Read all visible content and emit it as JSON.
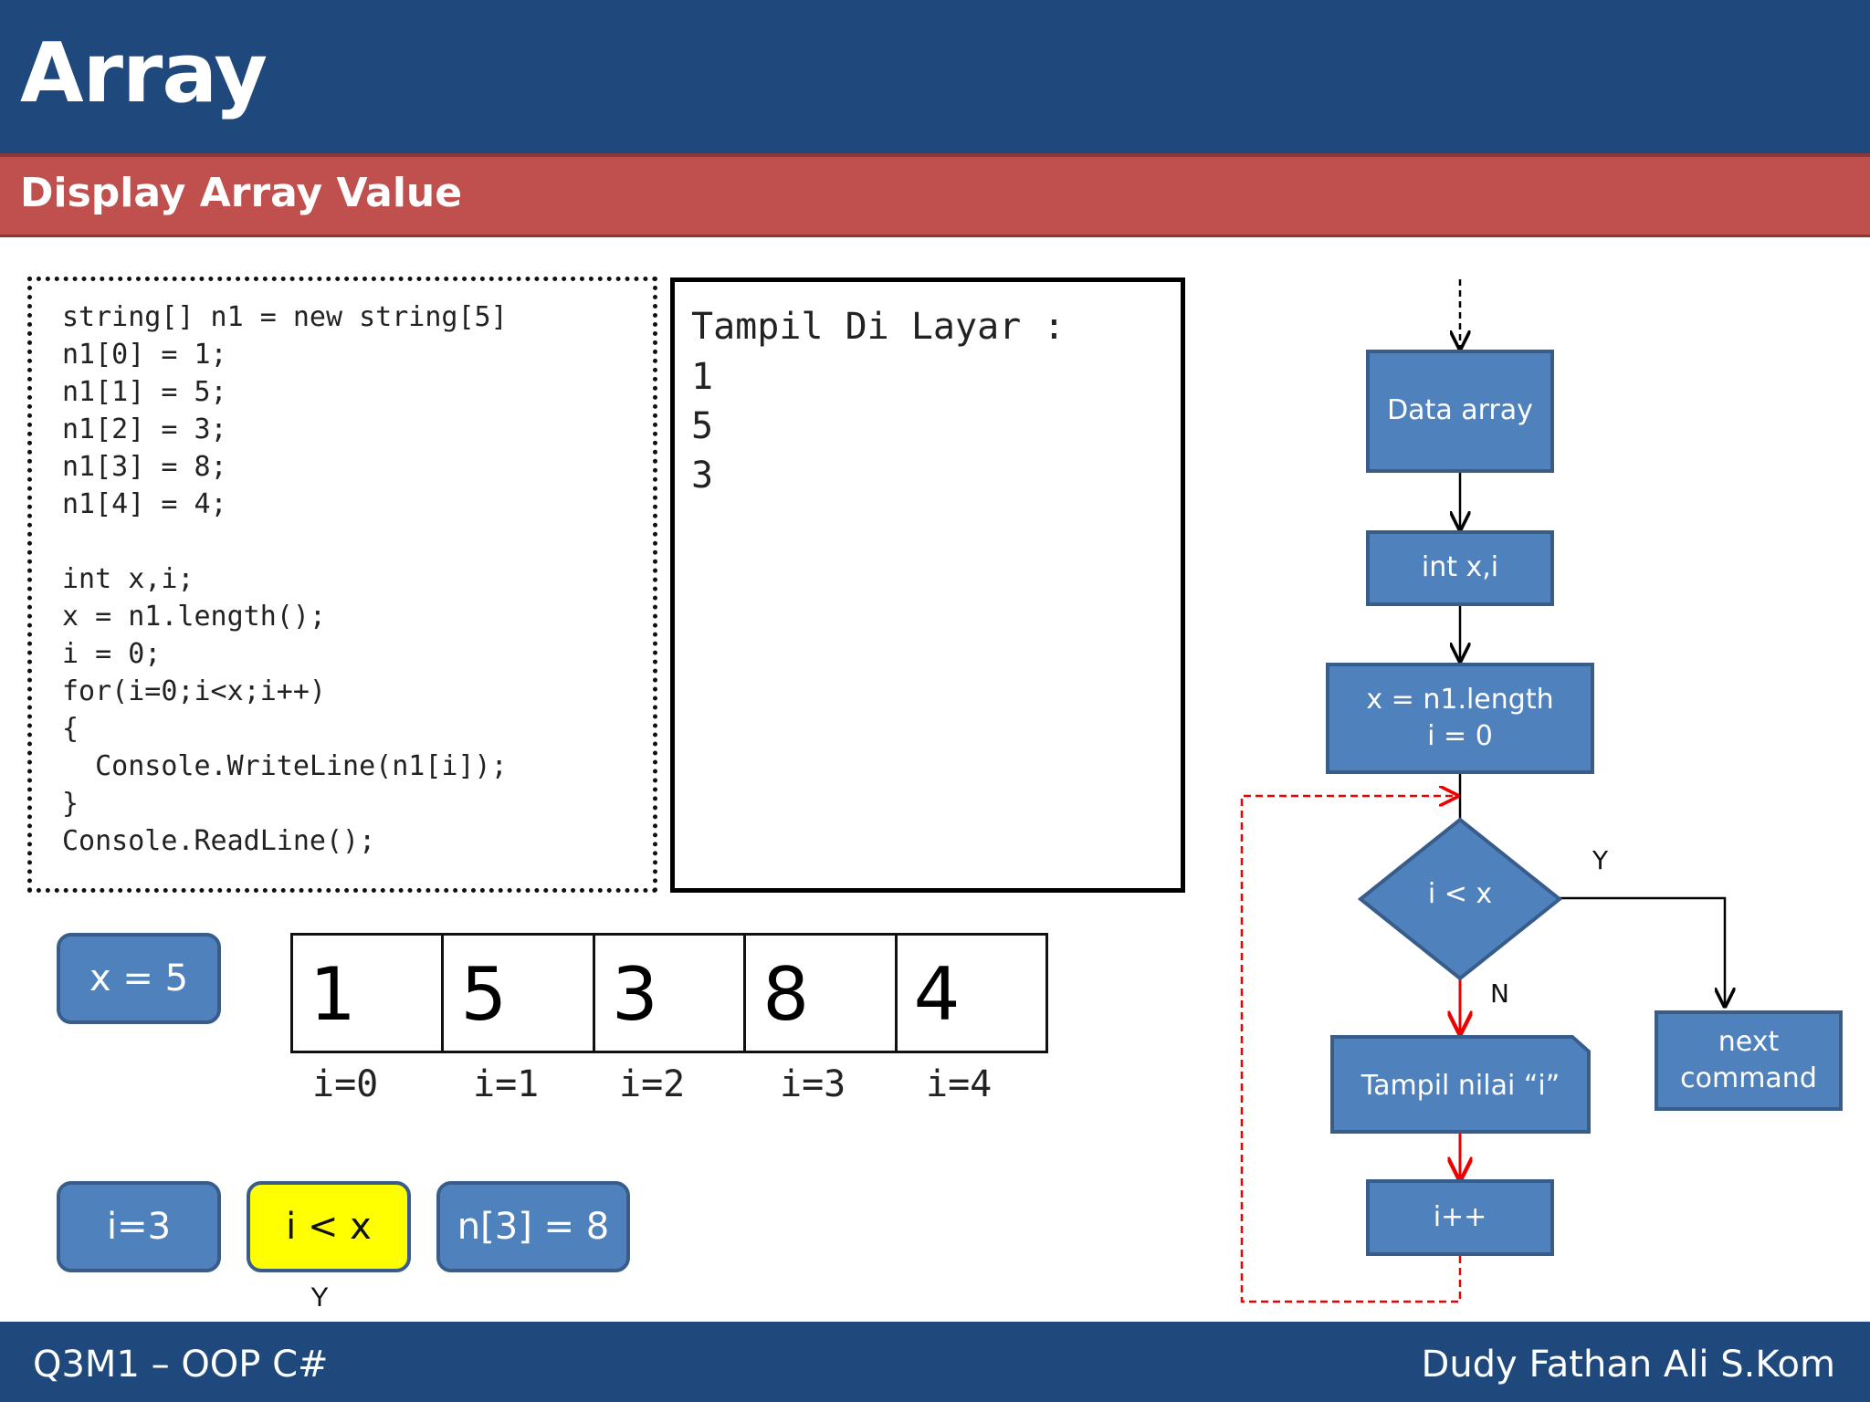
{
  "header": {
    "title": "Array",
    "subtitle": "Display Array Value"
  },
  "code": {
    "lines": [
      "string[] n1 = new string[5]",
      "n1[0] = 1;",
      "n1[1] = 5;",
      "n1[2] = 3;",
      "n1[3] = 8;",
      "n1[4] = 4;",
      "",
      "int x,i;",
      "x = n1.length();",
      "i = 0;",
      "for(i=0;i<x;i++)",
      "{",
      "  Console.WriteLine(n1[i]);",
      "}",
      "Console.ReadLine();"
    ]
  },
  "output": {
    "title": "Tampil Di Layar :",
    "lines": [
      "1",
      "5",
      "3"
    ]
  },
  "variables": {
    "x": "x = 5",
    "i": "i=3",
    "condition": "i < x",
    "condition_result": "Y",
    "value": "n[3] = 8"
  },
  "array": {
    "values": [
      "1",
      "5",
      "3",
      "8",
      "4"
    ],
    "indexes": [
      "i=0",
      "i=1",
      "i=2",
      "i=3",
      "i=4"
    ]
  },
  "flowchart": {
    "data_array": "Data array",
    "declare": "int x,i",
    "init_line1": "x = n1.length",
    "init_line2": "i = 0",
    "decision": "i < x",
    "yes_label": "Y",
    "no_label": "N",
    "display": "Tampil nilai “i”",
    "next_line1": "next",
    "next_line2": "command",
    "increment": "i++"
  },
  "footer": {
    "left": "Q3M1 – OOP C#",
    "right": "Dudy Fathan Ali S.Kom"
  }
}
